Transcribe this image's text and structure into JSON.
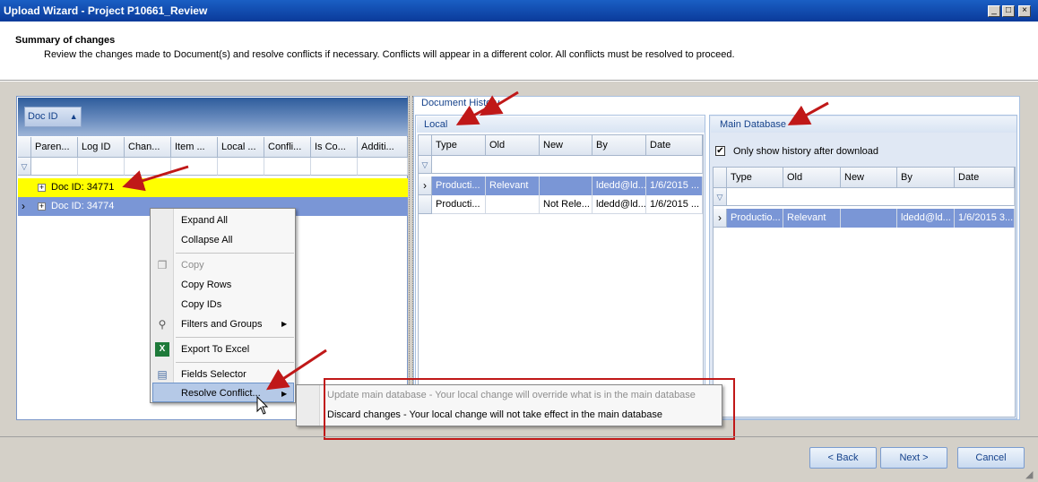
{
  "window": {
    "title": "Upload Wizard - Project P10661_Review",
    "min_glyph": "_",
    "max_glyph": "□",
    "close_glyph": "×"
  },
  "header": {
    "title": "Summary of changes",
    "description": "Review the changes made to Document(s) and resolve conflicts if necessary.  Conflicts will appear in a different color.  All conflicts must be resolved to proceed."
  },
  "grid": {
    "group_chip": "Doc ID",
    "group_chip_sort": "▲",
    "columns": [
      "Paren...",
      "Log ID",
      "Chan...",
      "Item ...",
      "Local ...",
      "Confli...",
      "Is Co...",
      "Additi..."
    ],
    "rows": [
      {
        "label": "Doc ID: 34771",
        "expander": "+"
      },
      {
        "label": "Doc ID: 34774",
        "expander": "+",
        "indicator": "›"
      }
    ],
    "filter_icon": "▽"
  },
  "history": {
    "title": "Document History",
    "local": {
      "title": "Local",
      "columns": [
        "Type",
        "Old",
        "New",
        "By",
        "Date"
      ],
      "rows": [
        {
          "indicator": "›",
          "cells": [
            "Producti...",
            "Relevant",
            "",
            "ldedd@ld...",
            "1/6/2015 ..."
          ]
        },
        {
          "indicator": "",
          "cells": [
            "Producti...",
            "",
            "Not Rele...",
            "ldedd@ld...",
            "1/6/2015 ..."
          ]
        }
      ]
    },
    "maindb": {
      "title": "Main Database",
      "checkbox_label": "Only show history after download",
      "checkbox_mark": "✔",
      "columns": [
        "Type",
        "Old",
        "New",
        "By",
        "Date"
      ],
      "rows": [
        {
          "indicator": "›",
          "cells": [
            "Productio...",
            "Relevant",
            "",
            "ldedd@ld...",
            "1/6/2015 3..."
          ]
        }
      ]
    }
  },
  "context_menu": {
    "expand_all": "Expand All",
    "collapse_all": "Collapse All",
    "copy": "Copy",
    "copy_rows": "Copy Rows",
    "copy_ids": "Copy IDs",
    "filters_groups": "Filters and Groups",
    "export_excel": "Export To Excel",
    "fields_selector": "Fields Selector",
    "resolve_conflict": "Resolve Conflict...",
    "submenu_arrow": "▶"
  },
  "submenu": {
    "update_main": "Update main database - Your local change will override what is in the main database",
    "discard": "Discard changes - Your local change will not take effect in the main database"
  },
  "buttons": {
    "back": "< Back",
    "next": "Next >",
    "cancel": "Cancel"
  },
  "colors": {
    "conflict_row": "#ffff00",
    "selected_row": "#7a96d6",
    "annotation_red": "#c01818"
  }
}
